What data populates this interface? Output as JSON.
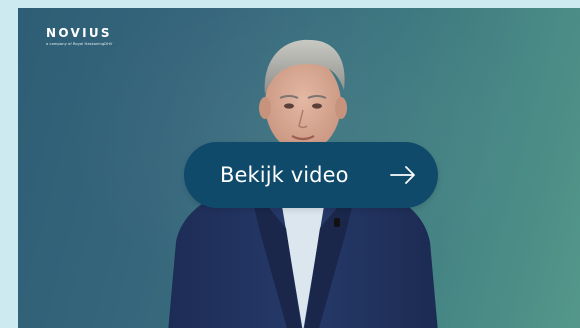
{
  "brand": {
    "name": "NOVIUS",
    "tagline": "a company of Royal HaskoningDHV"
  },
  "cta": {
    "label": "Bekijk video",
    "icon": "arrow-right-icon"
  },
  "colors": {
    "page_background": "#cdeaf0",
    "cta_background": "#0f4a6b",
    "video_gradient_start": "#2d5e75",
    "video_gradient_end": "#54978a"
  }
}
